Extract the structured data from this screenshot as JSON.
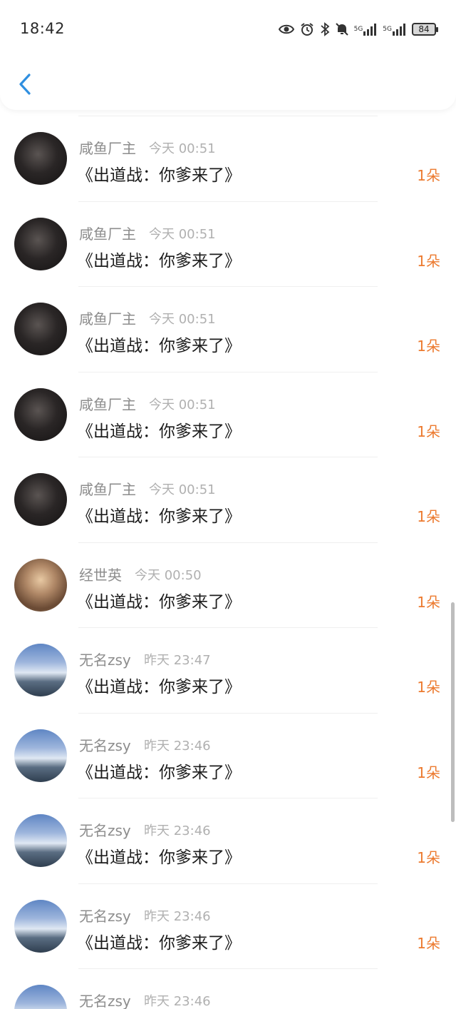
{
  "status_bar": {
    "time": "18:42",
    "battery": "84",
    "network_1": "5G",
    "network_2": "5G"
  },
  "header": {
    "back_icon": "chevron-left-icon",
    "accent_color": "#2f8fe0"
  },
  "rows": [
    {
      "name": "咸鱼厂主",
      "time": "今天 00:51",
      "title": "《出道战：你爹来了》",
      "count": "1朵",
      "avatar": "dark"
    },
    {
      "name": "咸鱼厂主",
      "time": "今天 00:51",
      "title": "《出道战：你爹来了》",
      "count": "1朵",
      "avatar": "dark"
    },
    {
      "name": "咸鱼厂主",
      "time": "今天 00:51",
      "title": "《出道战：你爹来了》",
      "count": "1朵",
      "avatar": "dark"
    },
    {
      "name": "咸鱼厂主",
      "time": "今天 00:51",
      "title": "《出道战：你爹来了》",
      "count": "1朵",
      "avatar": "dark"
    },
    {
      "name": "咸鱼厂主",
      "time": "今天 00:51",
      "title": "《出道战：你爹来了》",
      "count": "1朵",
      "avatar": "dark"
    },
    {
      "name": "经世英",
      "time": "今天 00:50",
      "title": "《出道战：你爹来了》",
      "count": "1朵",
      "avatar": "girl"
    },
    {
      "name": "无名zsy",
      "time": "昨天 23:47",
      "title": "《出道战：你爹来了》",
      "count": "1朵",
      "avatar": "sky"
    },
    {
      "name": "无名zsy",
      "time": "昨天 23:46",
      "title": "《出道战：你爹来了》",
      "count": "1朵",
      "avatar": "sky"
    },
    {
      "name": "无名zsy",
      "time": "昨天 23:46",
      "title": "《出道战：你爹来了》",
      "count": "1朵",
      "avatar": "sky"
    },
    {
      "name": "无名zsy",
      "time": "昨天 23:46",
      "title": "《出道战：你爹来了》",
      "count": "1朵",
      "avatar": "sky"
    },
    {
      "name": "无名zsy",
      "time": "昨天 23:46",
      "title": "",
      "count": "",
      "avatar": "sky"
    }
  ],
  "colors": {
    "count_orange": "#ec7a2f",
    "name_gray": "#8d8d8d",
    "time_gray": "#b0b0b0"
  }
}
